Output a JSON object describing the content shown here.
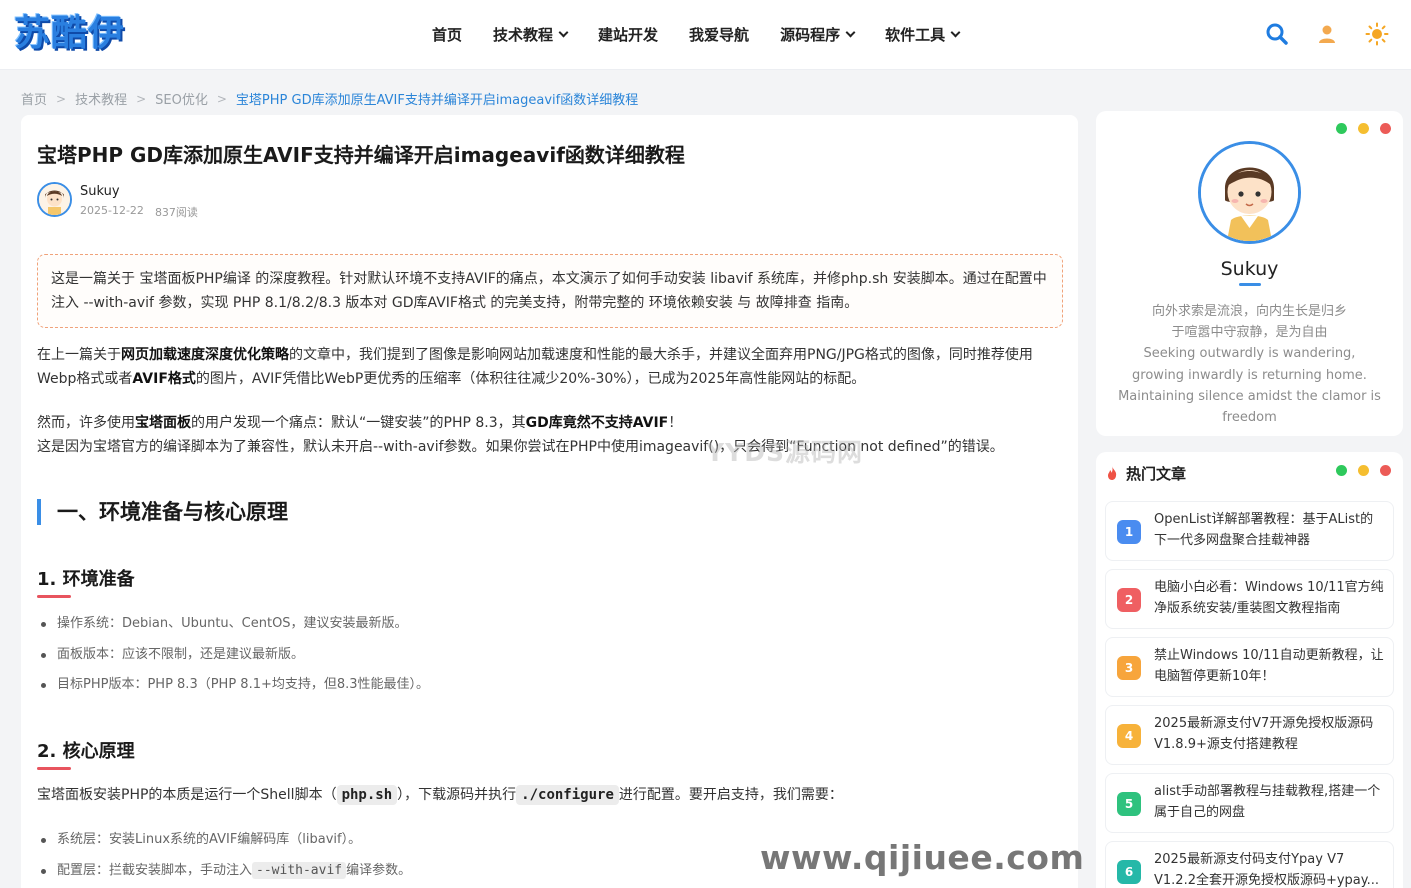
{
  "header": {
    "logo": "苏酷伊",
    "nav": [
      {
        "label": "首页",
        "dropdown": false
      },
      {
        "label": "技术教程",
        "dropdown": true
      },
      {
        "label": "建站开发",
        "dropdown": false
      },
      {
        "label": "我爱导航",
        "dropdown": false
      },
      {
        "label": "源码程序",
        "dropdown": true
      },
      {
        "label": "软件工具",
        "dropdown": true
      }
    ],
    "icons": [
      "search-icon",
      "user-icon",
      "sun-icon"
    ]
  },
  "breadcrumb": [
    "首页",
    "技术教程",
    "SEO优化",
    "宝塔PHP GD库添加原生AVIF支持并编译开启imageavif函数详细教程"
  ],
  "article": {
    "title": "宝塔PHP GD库添加原生AVIF支持并编译开启imageavif函数详细教程",
    "author": "Sukuy",
    "date": "2025-12-22",
    "views": "837阅读",
    "summary": "这是一篇关于 宝塔面板PHP编译 的深度教程。针对默认环境不支持AVIF的痛点，本文演示了如何手动安装 libavif 系统库，并修php.sh 安装脚本。通过在配置中注入 --with-avif 参数，实现 PHP 8.1/8.2/8.3 版本对 GD库AVIF格式 的完美支持，附带完整的 环境依赖安装 与 故障排查 指南。",
    "p1": {
      "a": "在上一篇关于",
      "b": "网页加载速度深度优化策略",
      "c": "的文章中，我们提到了图像是影响网站加载速度和性能的最大杀手，并建议全面弃用PNG/JPG格式的图像，同时推荐使用Webp格式或者",
      "d": "AVIF格式",
      "e": "的图片，AVIF凭借比WebP更优秀的压缩率（体积往往减少20%-30%），已成为2025年高性能网站的标配。"
    },
    "p2": {
      "a": "然而，许多使用",
      "b": "宝塔面板",
      "c": "的用户发现一个痛点：默认“一键安装”的PHP 8.3，其",
      "d": "GD库竟然不支持AVIF",
      "e": "！"
    },
    "p3": "这是因为宝塔官方的编译脚本为了兼容性，默认未开启--with-avif参数。如果你尝试在PHP中使用imageavif()，只会得到“Function not defined”的错误。",
    "h2": "一、环境准备与核心原理",
    "h3a": "1. 环境准备",
    "list_a": [
      "操作系统：Debian、Ubuntu、CentOS，建议安装最新版。",
      "面板版本：应该不限制，还是建议最新版。",
      "目标PHP版本：PHP 8.3（PHP 8.1+均支持，但8.3性能最佳）。"
    ],
    "h3b": "2. 核心原理",
    "p4": {
      "a": "宝塔面板安装PHP的本质是运行一个Shell脚本（",
      "code1": "php.sh",
      "b": "），下载源码并执行",
      "code2": "./configure",
      "c": "进行配置。要开启支持，我们需要："
    },
    "list_b": [
      {
        "text": "系统层：安装Linux系统的AVIF编解码库（libavif）。"
      },
      {
        "pre": "配置层：拦截安装脚本，手动注入",
        "code": "--with-avif",
        "post": "编译参数。"
      }
    ],
    "watermark1": "YYDS源码网",
    "watermark2": "www.qijiuee.com"
  },
  "profile": {
    "name": "Sukuy",
    "bio": "向外求索是流浪，向内生长是归乡\n于喧嚣中守寂静，是为自由\nSeeking outwardly is wandering, growing inwardly is returning home. Maintaining silence amidst the clamor is freedom"
  },
  "hot": {
    "title": "热门文章",
    "items": [
      {
        "rank": "1",
        "text": "OpenList详解部署教程：基于AList的下一代多网盘聚合挂载神器",
        "color": "#4a8cf0"
      },
      {
        "rank": "2",
        "text": "电脑小白必看：Windows 10/11官方纯净版系统安装/重装图文教程指南",
        "color": "#ef5f62"
      },
      {
        "rank": "3",
        "text": "禁止Windows 10/11自动更新教程，让电脑暂停更新10年！",
        "color": "#f7a53c"
      },
      {
        "rank": "4",
        "text": "2025最新源支付V7开源免授权版源码V1.8.9+源支付搭建教程",
        "color": "#f7b23a"
      },
      {
        "rank": "5",
        "text": "alist手动部署教程与挂载教程,搭建一个属于自己的网盘",
        "color": "#2ec27e"
      },
      {
        "rank": "6",
        "text": "2025最新源支付码支付Ypay V7 V1.2.2全套开源免授权版源码+ypay...",
        "color": "#25b8a8"
      }
    ]
  },
  "colors": {
    "accent": "#3a8ee6",
    "dot_green": "#2ec95c",
    "dot_yellow": "#f5be30",
    "dot_red": "#ec5b57"
  }
}
